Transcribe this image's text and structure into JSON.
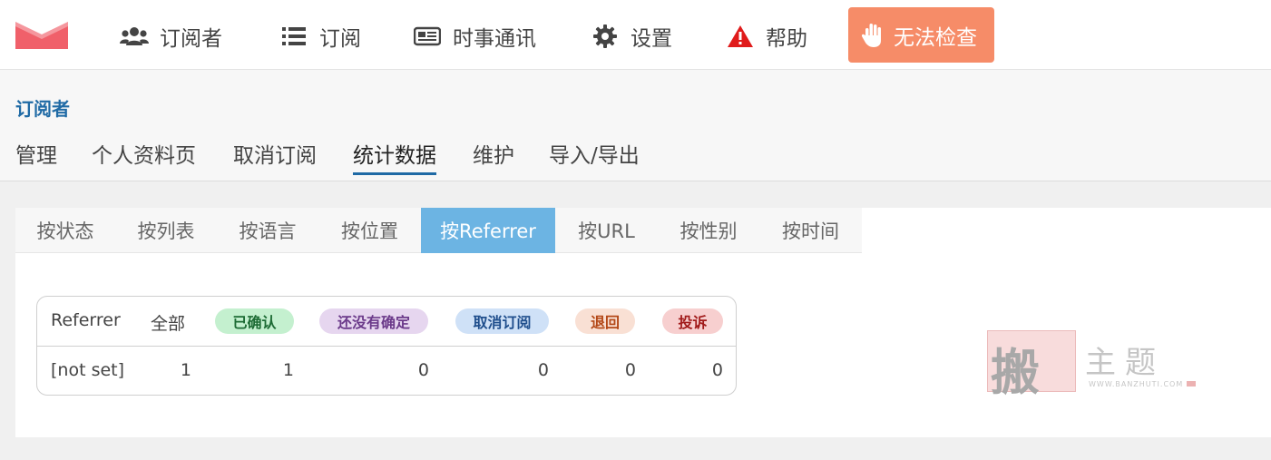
{
  "navbar": {
    "items": [
      {
        "id": "subscribers",
        "label": "订阅者",
        "icon": "users-icon"
      },
      {
        "id": "lists",
        "label": "订阅",
        "icon": "list-icon"
      },
      {
        "id": "newsletters",
        "label": "时事通讯",
        "icon": "newspaper-icon"
      },
      {
        "id": "settings",
        "label": "设置",
        "icon": "gear-icon"
      },
      {
        "id": "help",
        "label": "帮助",
        "icon": "warning-icon"
      }
    ],
    "check_button": {
      "label": "无法检查",
      "icon": "hand-icon"
    }
  },
  "subheader": {
    "title": "订阅者",
    "items": [
      "管理",
      "个人资料页",
      "取消订阅",
      "统计数据",
      "维护",
      "导入/导出"
    ],
    "active": "统计数据"
  },
  "tabs": {
    "items": [
      "按状态",
      "按列表",
      "按语言",
      "按位置",
      "按Referrer",
      "按URL",
      "按性别",
      "按时间"
    ],
    "active": "按Referrer"
  },
  "table": {
    "headers": {
      "referrer": "Referrer",
      "all": "全部",
      "confirmed": "已确认",
      "unconfirmed": "还没有确定",
      "unsubscribed": "取消订阅",
      "bounced": "退回",
      "complaint": "投诉"
    },
    "rows": [
      {
        "referrer": "[not set]",
        "all": "1",
        "confirmed": "1",
        "unconfirmed": "0",
        "unsubscribed": "0",
        "bounced": "0",
        "complaint": "0"
      }
    ]
  },
  "watermark": {
    "main": "搬",
    "side": "主题",
    "url": "WWW.BANZHUTI.COM"
  },
  "colors": {
    "accent": "#1f6aa5",
    "tab_active": "#6cb4e3",
    "check_button": "#f68c68",
    "logo": "#f0606a",
    "badge_confirmed_bg": "#c4f0cf",
    "badge_unconfirmed_bg": "#e6d6ef",
    "badge_unsubscribed_bg": "#cfe1f7",
    "badge_bounced_bg": "#f9e0d4",
    "badge_complaint_bg": "#f7cfcf"
  }
}
